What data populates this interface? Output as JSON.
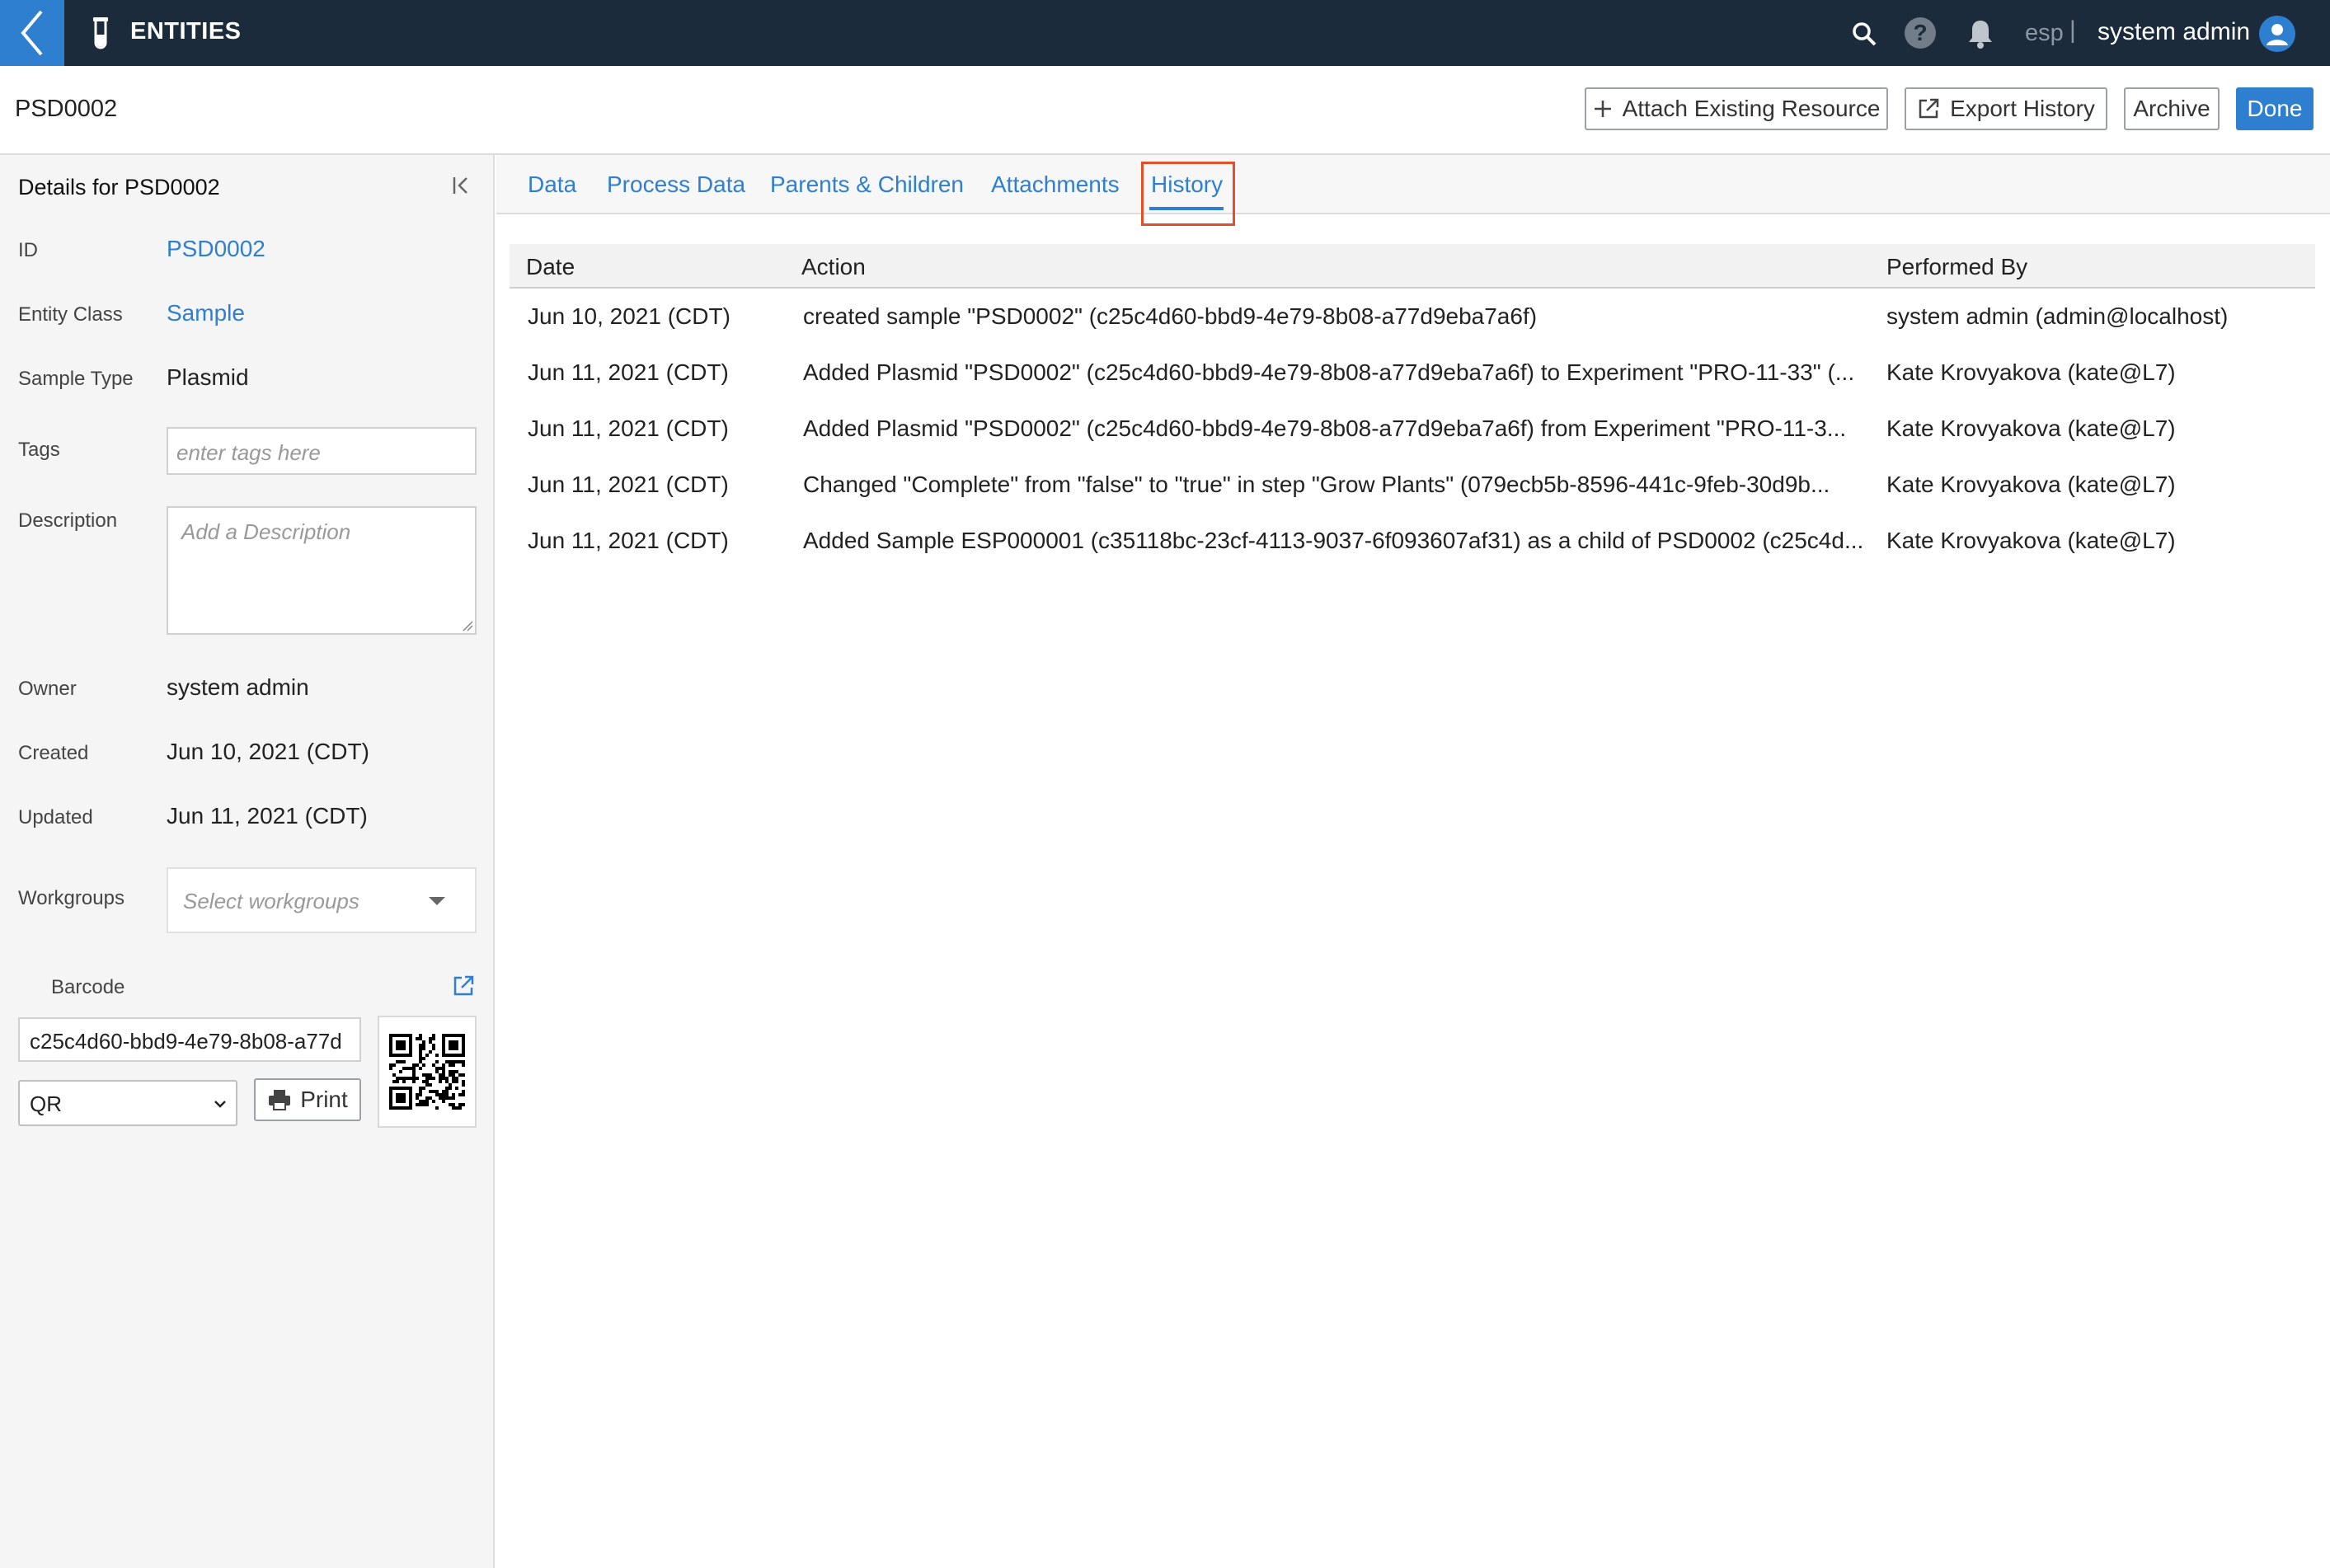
{
  "topbar": {
    "app_title": "ENTITIES",
    "lang": "esp",
    "separator": "|",
    "user": "system admin",
    "help_glyph": "?",
    "icons": [
      "back-icon",
      "test-tube-icon",
      "search-icon",
      "help-icon",
      "bell-icon",
      "user-avatar-icon"
    ]
  },
  "header": {
    "title": "PSD0002",
    "attach_label": "Attach Existing Resource",
    "export_label": "Export History",
    "archive_label": "Archive",
    "done_label": "Done"
  },
  "details": {
    "title": "Details for PSD0002",
    "id_label": "ID",
    "id_value": "PSD0002",
    "entity_class_label": "Entity Class",
    "entity_class_value": "Sample",
    "sample_type_label": "Sample Type",
    "sample_type_value": "Plasmid",
    "tags_label": "Tags",
    "tags_placeholder": "enter tags here",
    "description_label": "Description",
    "description_placeholder": "Add a Description",
    "owner_label": "Owner",
    "owner_value": "system admin",
    "created_label": "Created",
    "created_value": "Jun 10, 2021 (CDT)",
    "updated_label": "Updated",
    "updated_value": "Jun 11, 2021 (CDT)",
    "workgroups_label": "Workgroups",
    "workgroups_placeholder": "Select workgroups",
    "barcode_label": "Barcode",
    "barcode_value": "c25c4d60-bbd9-4e79-8b08-a77d",
    "barcode_type": "QR",
    "print_label": "Print"
  },
  "tabs": {
    "data": "Data",
    "process_data": "Process Data",
    "parents_children": "Parents & Children",
    "attachments": "Attachments",
    "history": "History",
    "active": "History"
  },
  "history": {
    "columns": {
      "date": "Date",
      "action": "Action",
      "performed_by": "Performed By"
    },
    "rows": [
      {
        "date": "Jun 10, 2021 (CDT)",
        "action": "created sample \"PSD0002\" (c25c4d60-bbd9-4e79-8b08-a77d9eba7a6f)",
        "by": "system admin (admin@localhost)"
      },
      {
        "date": "Jun 11, 2021 (CDT)",
        "action": "Added Plasmid \"PSD0002\" (c25c4d60-bbd9-4e79-8b08-a77d9eba7a6f) to Experiment \"PRO-11-33\" (...",
        "by": "Kate Krovyakova (kate@L7)"
      },
      {
        "date": "Jun 11, 2021 (CDT)",
        "action": "Added Plasmid \"PSD0002\" (c25c4d60-bbd9-4e79-8b08-a77d9eba7a6f) from Experiment \"PRO-11-3...",
        "by": "Kate Krovyakova (kate@L7)"
      },
      {
        "date": "Jun 11, 2021 (CDT)",
        "action": "Changed \"Complete\" from \"false\" to \"true\" in step \"Grow Plants\" (079ecb5b-8596-441c-9feb-30d9b...",
        "by": "Kate Krovyakova (kate@L7)"
      },
      {
        "date": "Jun 11, 2021 (CDT)",
        "action": "Added Sample ESP000001 (c35118bc-23cf-4113-9037-6f093607af31) as a child of PSD0002 (c25c4d...",
        "by": "Kate Krovyakova (kate@L7)"
      }
    ]
  },
  "colors": {
    "topbar": "#1c2b3c",
    "accent": "#2f7fd0",
    "highlight": "#e0502b",
    "panel": "#f5f5f5"
  }
}
